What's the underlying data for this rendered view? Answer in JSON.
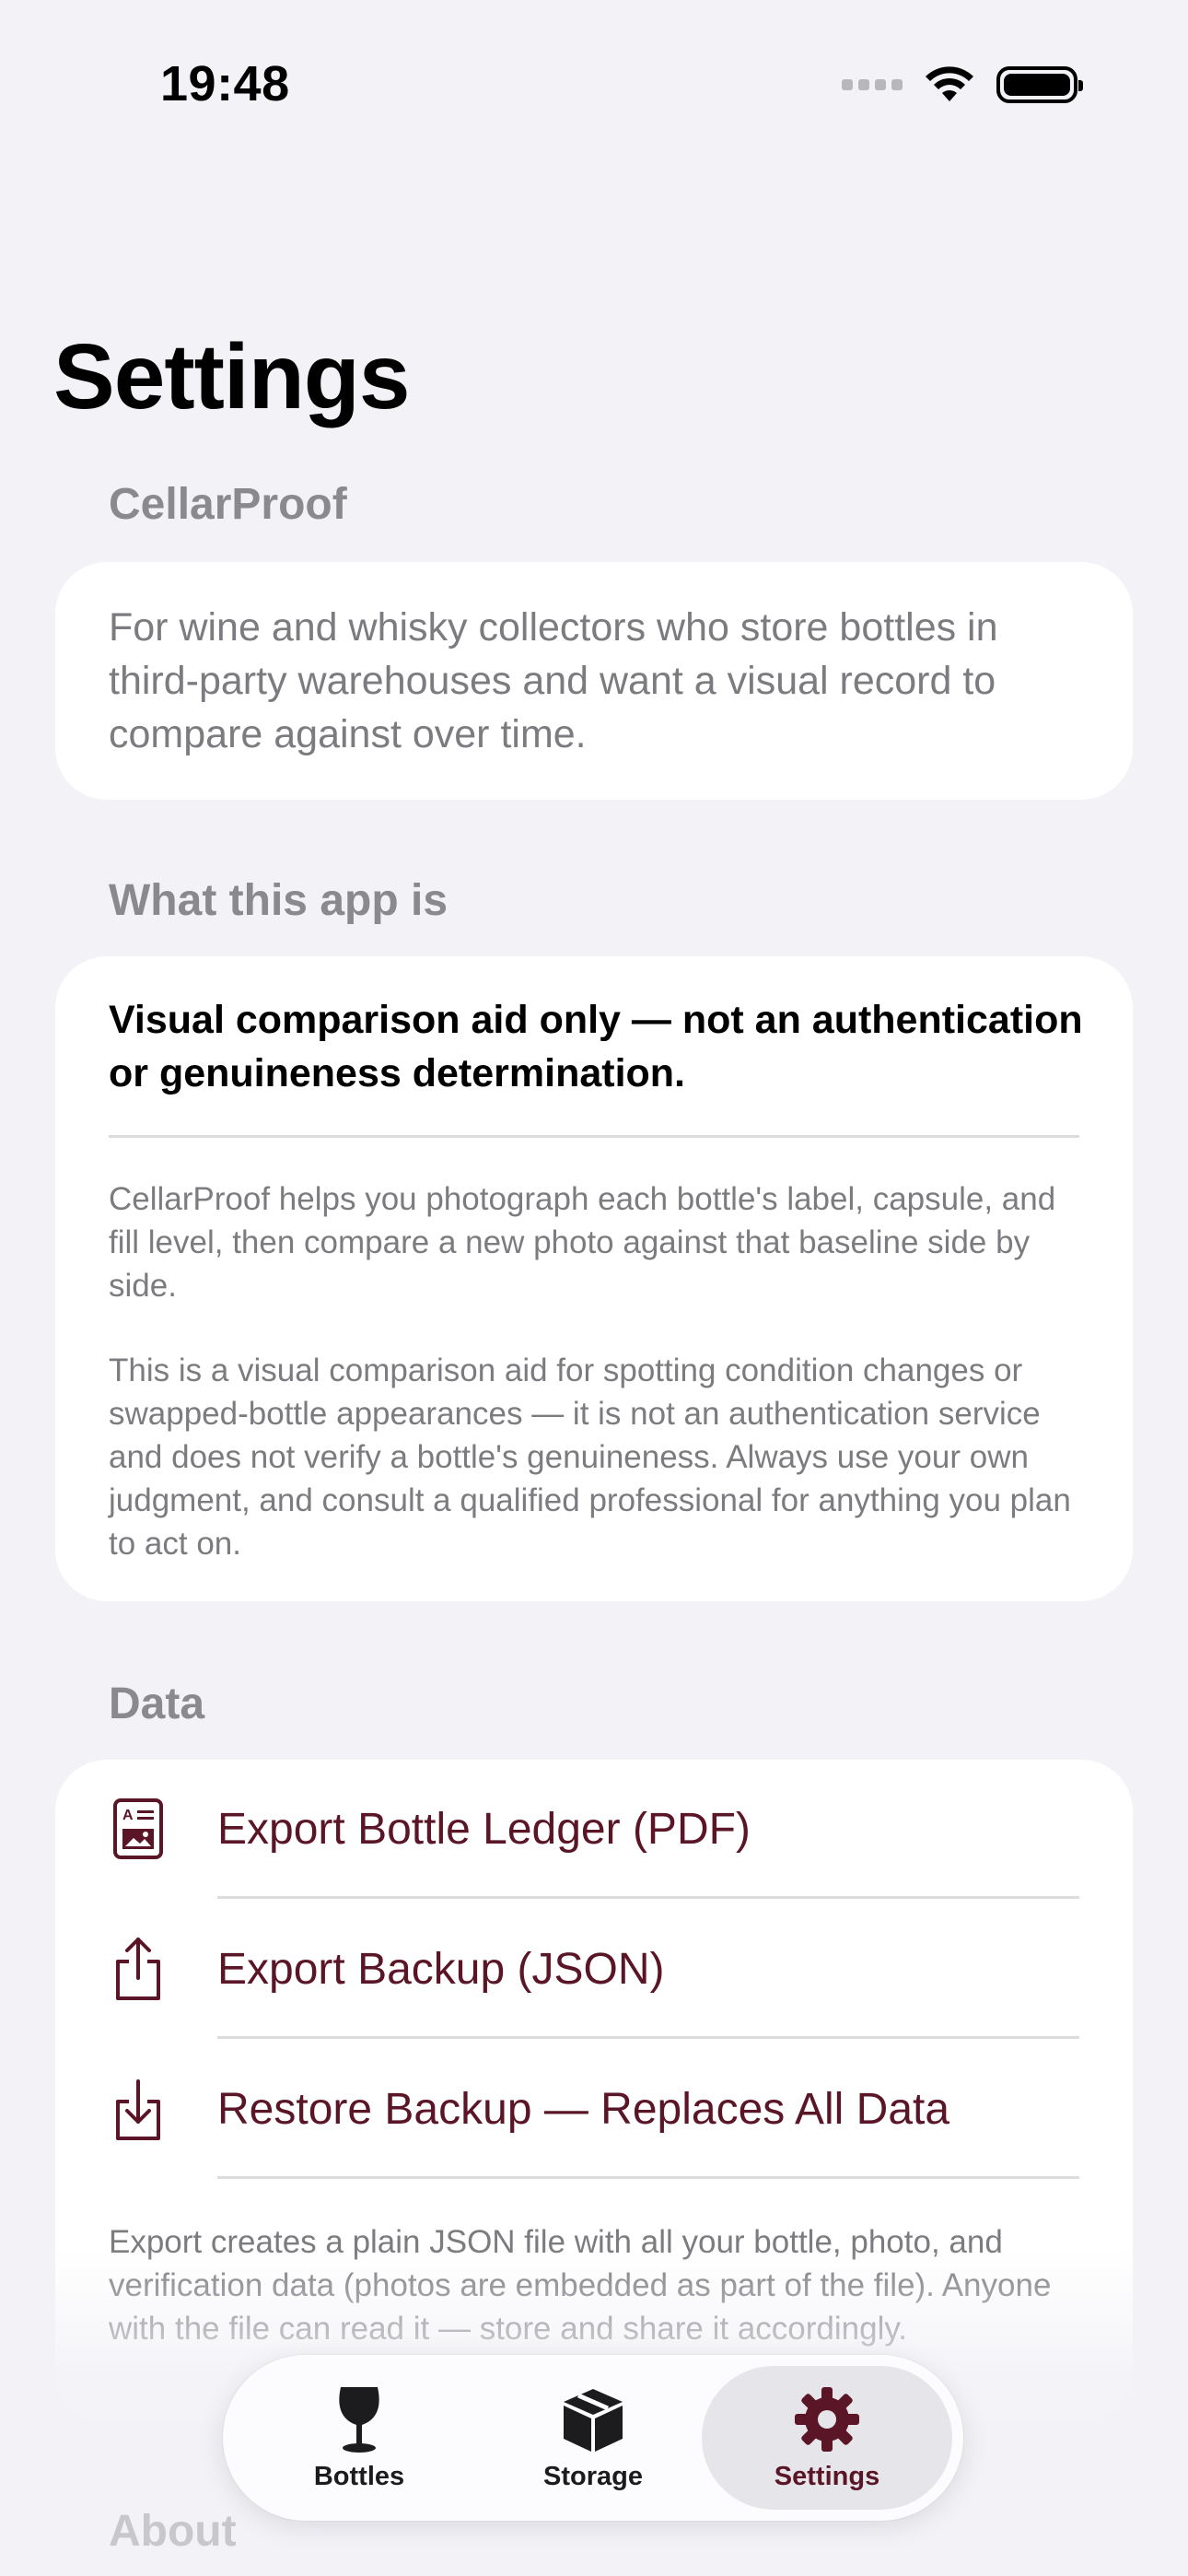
{
  "status": {
    "time": "19:48"
  },
  "title": "Settings",
  "intro": {
    "header": "CellarProof",
    "text": "For wine and whisky collectors who store bottles in third-party warehouses and want a visual record to compare against over time."
  },
  "about": {
    "header": "What this app is",
    "headline": "Visual comparison aid only — not an authentication or genuineness determination.",
    "paragraph1": "CellarProof helps you photograph each bottle's label, capsule, and fill level, then compare a new photo against that baseline side by side.",
    "paragraph2": "This is a visual comparison aid for spotting condition changes or swapped-bottle appearances — it is not an authentication service and does not verify a bottle's genuineness. Always use your own judgment, and consult a qualified professional for anything you plan to act on."
  },
  "data": {
    "header": "Data",
    "rows": [
      {
        "label": "Export Bottle Ledger (PDF)",
        "icon": "document-image-icon"
      },
      {
        "label": "Export Backup (JSON)",
        "icon": "share-upload-icon"
      },
      {
        "label": "Restore Backup — Replaces All Data",
        "icon": "download-tray-icon"
      }
    ],
    "footnote": "Export creates a plain JSON file with all your bottle, photo, and verification data (photos are embedded as part of the file). Anyone with the file can read it — store and share it accordingly."
  },
  "next_section_header": "About",
  "tabs": [
    {
      "label": "Bottles",
      "icon": "wine-glass-icon",
      "active": false
    },
    {
      "label": "Storage",
      "icon": "box-icon",
      "active": false
    },
    {
      "label": "Settings",
      "icon": "gear-icon",
      "active": true
    }
  ],
  "colors": {
    "accent": "#5a1526",
    "background": "#f2f2f7",
    "secondary_text": "#7c7c80",
    "section_header": "#8a8a8e"
  }
}
